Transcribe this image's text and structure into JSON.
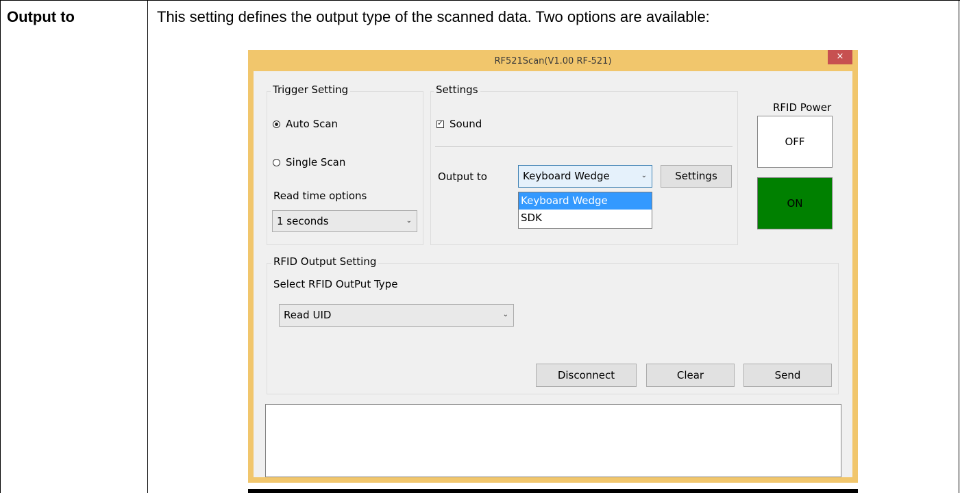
{
  "doc": {
    "row_label": "Output to",
    "row_description": "This setting defines the output type of the scanned data. Two options are available:"
  },
  "window": {
    "title": "RF521Scan(V1.00 RF-521)",
    "close_glyph": "×"
  },
  "trigger": {
    "group_title": "Trigger Setting",
    "auto_scan_label": "Auto Scan",
    "auto_scan_selected": true,
    "single_scan_label": "Single Scan",
    "single_scan_selected": false,
    "read_time_label": "Read time options",
    "read_time_value": "1 seconds"
  },
  "settings": {
    "group_title": "Settings",
    "sound_label": "Sound",
    "sound_checked": true,
    "output_label": "Output to",
    "output_value": "Keyboard Wedge",
    "settings_button": "Settings",
    "output_options": [
      "Keyboard Wedge",
      "SDK"
    ],
    "output_selected_index": 0
  },
  "rfid_power": {
    "label": "RFID Power",
    "off_label": "OFF",
    "on_label": "ON",
    "on_color": "#008000"
  },
  "rfid_output": {
    "group_title": "RFID Output Setting",
    "select_label": "Select RFID OutPut Type",
    "select_value": "Read UID"
  },
  "actions": {
    "disconnect": "Disconnect",
    "clear": "Clear",
    "send": "Send"
  },
  "icons": {
    "dropdown_arrow": "chevron-down-icon",
    "close": "close-icon"
  },
  "colors": {
    "window_frame": "#f1c66c",
    "close_button": "#c75050",
    "selection": "#3399ff"
  }
}
